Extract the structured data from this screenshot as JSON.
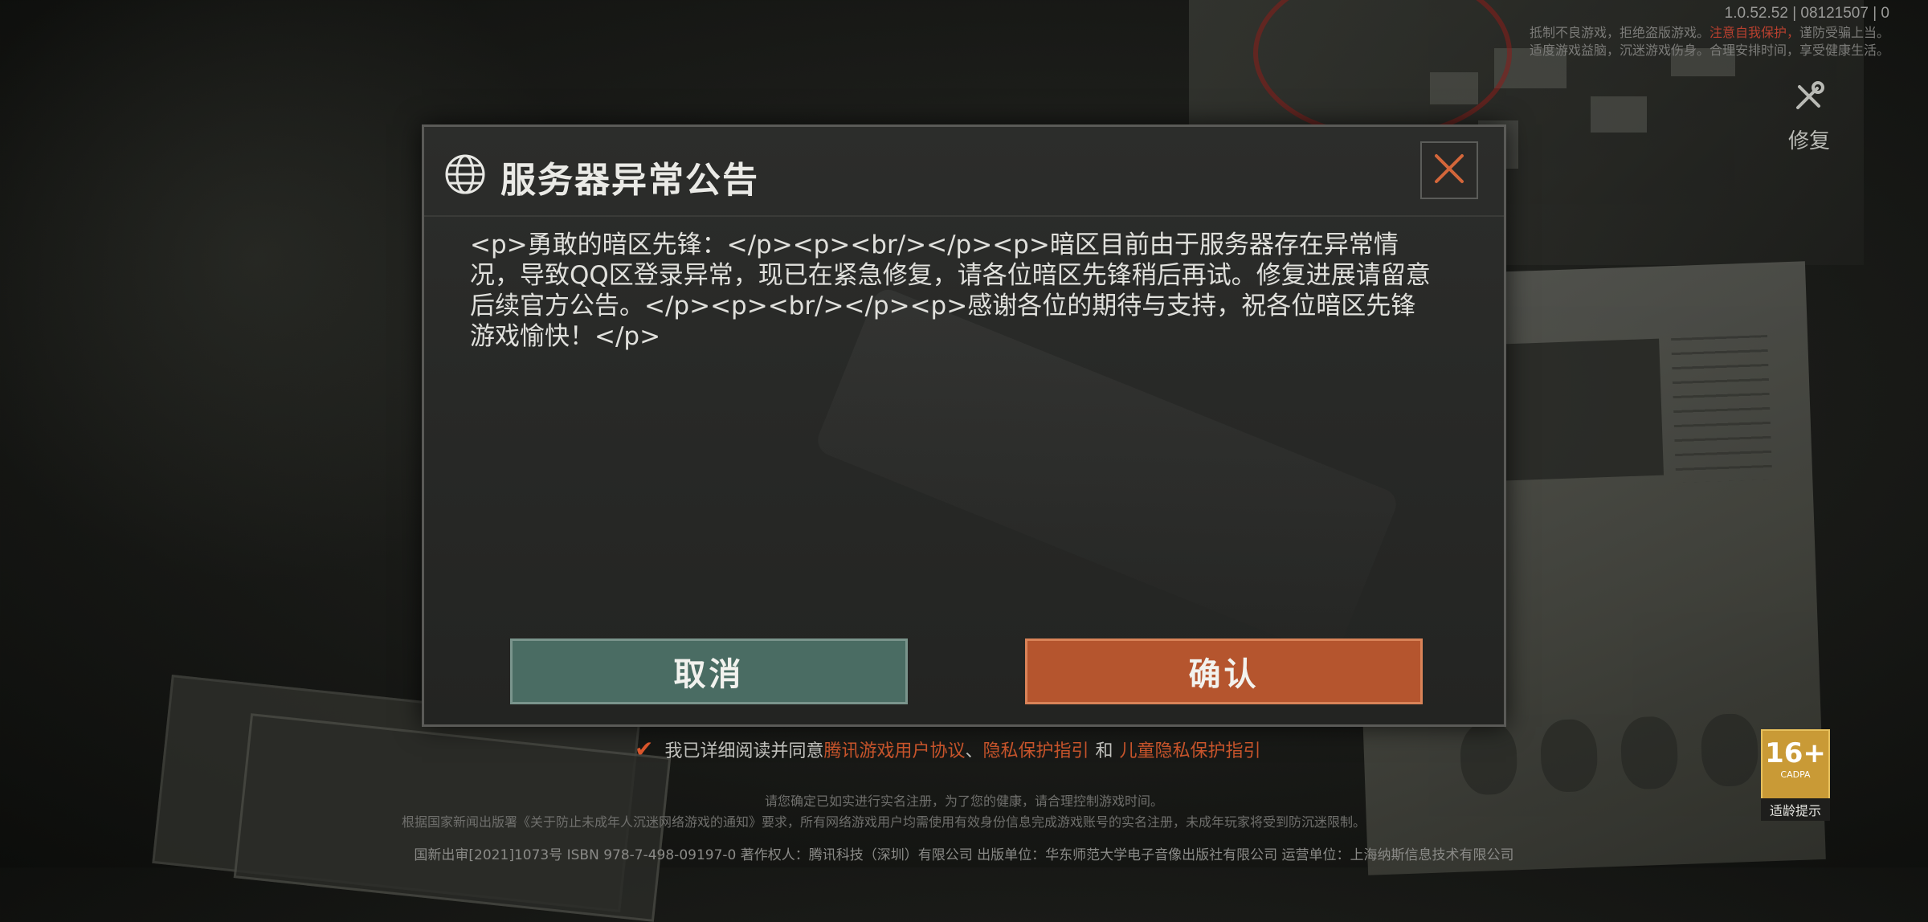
{
  "version": "1.0.52.52 | 08121507 | 0",
  "notice": {
    "line1a": "抵制不良游戏，拒绝盗版游戏。",
    "line1b": "注意自我保护，",
    "line1c": "谨防受骗上当。",
    "line2": "适度游戏益脑，沉迷游戏伤身。合理安排时间，享受健康生活。"
  },
  "repair": {
    "icon": "wrench-icon",
    "label": "修复"
  },
  "dialog": {
    "title": "服务器异常公告",
    "body": "<p>勇敢的暗区先锋：</p><p><br/></p><p>暗区目前由于服务器存在异常情况，导致QQ区登录异常，现已在紧急修复，请各位暗区先锋稍后再试。修复进展请留意后续官方公告。</p><p><br/></p><p>感谢各位的期待与支持，祝各位暗区先锋游戏愉快！</p>",
    "cancel": "取消",
    "confirm": "确认"
  },
  "agreement": {
    "prefix": "我已详细阅读并同意",
    "link1": "腾讯游戏用户协议",
    "sep1": "、",
    "link2": "隐私保护指引",
    "sep2": "和",
    "link3": "儿童隐私保护指引"
  },
  "footer": {
    "line1": "请您确定已如实进行实名注册，为了您的健康，请合理控制游戏时间。",
    "line2": "根据国家新闻出版署《关于防止未成年人沉迷网络游戏的通知》要求，所有网络游戏用户均需使用有效身份信息完成游戏账号的实名注册，未成年玩家将受到防沉迷限制。",
    "line3": "国新出审[2021]1073号  ISBN 978-7-498-09197-0  著作权人：腾讯科技（深圳）有限公司  出版单位：华东师范大学电子音像出版社有限公司  运营单位：上海纳斯信息技术有限公司"
  },
  "age_badge": {
    "num": "16+",
    "org": "CADPA",
    "tip": "适龄提示"
  },
  "colors": {
    "accent": "#b5552e",
    "cancel": "#4a6c63",
    "link": "#c7542b"
  }
}
